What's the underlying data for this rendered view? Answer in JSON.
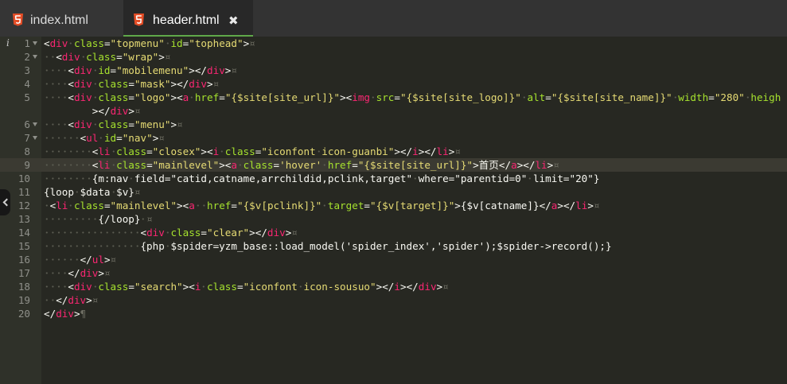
{
  "tabs": [
    {
      "label": "index.html",
      "icon": "html5-icon",
      "active": false
    },
    {
      "label": "header.html",
      "icon": "html5-icon",
      "active": true,
      "close_glyph": "✖"
    }
  ],
  "editor": {
    "info_marker": "i",
    "rows": [
      {
        "num": "1",
        "fold": true,
        "code": "<div class=\"topmenu\" id=\"tophead\">",
        "eol": "¤"
      },
      {
        "num": "2",
        "fold": true,
        "code": "  <div class=\"wrap\">",
        "eol": "¤"
      },
      {
        "num": "3",
        "code": "    <div id=\"mobilemenu\"></div>",
        "eol": "¤"
      },
      {
        "num": "4",
        "code": "    <div class=\"mask\"></div>",
        "eol": "¤"
      },
      {
        "num": "5",
        "code": "    <div class=\"logo\"><a href=\"{$site[site_url]}\"><img src=\"{$site[site_logo]}\" alt=\"{$site[site_name]}\" width=\"280\" heigh"
      },
      {
        "continuation": true,
        "code": "></div>",
        "eol": "¤"
      },
      {
        "num": "6",
        "fold": true,
        "code": "    <div class=\"menu\">",
        "eol": "¤"
      },
      {
        "num": "7",
        "fold": true,
        "code": "      <ul id=\"nav\">",
        "eol": "¤"
      },
      {
        "num": "8",
        "code": "        <li class=\"closex\"><i class=\"iconfont icon-guanbi\"></i></li>",
        "eol": "¤"
      },
      {
        "num": "9",
        "current": true,
        "code": "        <li class=\"mainlevel\"><a class='hover' href=\"{$site[site_url]}\">首页</a></li>",
        "eol": "¤"
      },
      {
        "num": "10",
        "code": "        {m:nav field=\"catid,catname,arrchildid,pclink,target\" where=\"parentid=0\" limit=\"20\"}"
      },
      {
        "num": "11",
        "code": "{loop $data $v}",
        "eol": "¤"
      },
      {
        "num": "12",
        "code": " <li class=\"mainlevel\"><a  href=\"{$v[pclink]}\" target=\"{$v[target]}\">{$v[catname]}</a></li>",
        "eol": "¤"
      },
      {
        "num": "13",
        "code": "         {/loop} ",
        "eol": "¤"
      },
      {
        "num": "14",
        "code": "                <div class=\"clear\"></div>",
        "eol": "¤"
      },
      {
        "num": "15",
        "code": "                {php $spider=yzm_base::load_model('spider_index','spider');$spider->record();}"
      },
      {
        "num": "16",
        "code": "      </ul>",
        "eol": "¤"
      },
      {
        "num": "17",
        "code": "    </div>",
        "eol": "¤"
      },
      {
        "num": "18",
        "code": "    <div class=\"search\"><i class=\"iconfont icon-sousuo\"></i></div>",
        "eol": "¤"
      },
      {
        "num": "19",
        "code": "  </div>",
        "eol": "¤"
      },
      {
        "num": "20",
        "code": "</div>",
        "eol": "¶"
      }
    ]
  },
  "colors": {
    "tag": "#f92672",
    "attr": "#a6e22e",
    "string": "#e6db74",
    "text": "#f8f8f2",
    "accent": "#5fa84a",
    "html5": "#e44d26"
  }
}
